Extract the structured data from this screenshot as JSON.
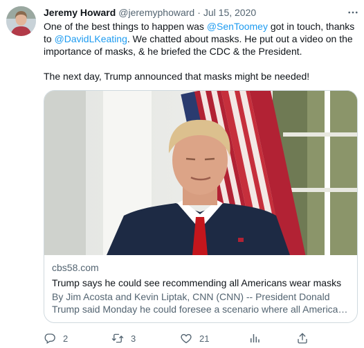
{
  "author": {
    "name": "Jeremy Howard",
    "handle": "@jeremyphoward",
    "separator": "·",
    "date": "Jul 15, 2020"
  },
  "tweet": {
    "line1_a": "One of the best things to happen was ",
    "mention1": "@SenToomey",
    "line1_b": " got in touch, thanks to ",
    "mention2": "@DavidLKeating",
    "line1_c": ". We chatted about masks. He put out a video on the importance of masks, & he briefed the CDC & the President.",
    "line2": "The next day, Trump announced that masks might be needed!"
  },
  "card": {
    "domain": "cbs58.com",
    "title": "Trump says he could see recommending all Americans wear masks",
    "description": "By Jim Acosta and Kevin Liptak, CNN (CNN) -- President Donald Trump said Monday he could foresee a scenario where all Americans wear masks"
  },
  "actions": {
    "replies": "2",
    "retweets": "3",
    "likes": "21"
  },
  "icons": {
    "more": "more-icon",
    "reply": "reply-icon",
    "retweet": "retweet-icon",
    "like": "like-icon",
    "views": "views-icon",
    "share": "share-icon"
  },
  "colors": {
    "link": "#1d9bf0",
    "secondary_text": "#536471",
    "border": "#cfd9de"
  }
}
